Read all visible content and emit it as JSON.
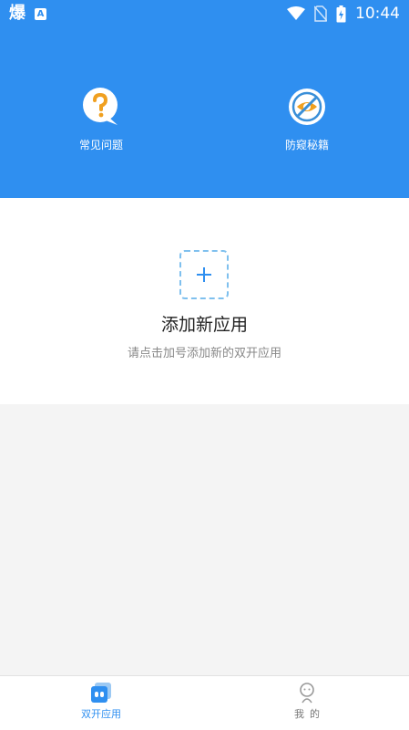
{
  "status_bar": {
    "app_glyph": "爆",
    "notify_glyph": "A",
    "time": "10:44"
  },
  "features": [
    {
      "label": "常见问题",
      "icon": "question-bubble-icon"
    },
    {
      "label": "防窥秘籍",
      "icon": "eye-slash-icon"
    }
  ],
  "empty_state": {
    "title": "添加新应用",
    "subtitle": "请点击加号添加新的双开应用",
    "icon": "plus-icon"
  },
  "tabs": [
    {
      "label": "双开应用",
      "icon": "dual-app-icon",
      "active": true
    },
    {
      "label": "我的",
      "icon": "user-icon",
      "active": false
    }
  ],
  "colors": {
    "primary": "#2f8ff0",
    "orange": "#f0a020",
    "list_bg": "#f4f4f4"
  }
}
